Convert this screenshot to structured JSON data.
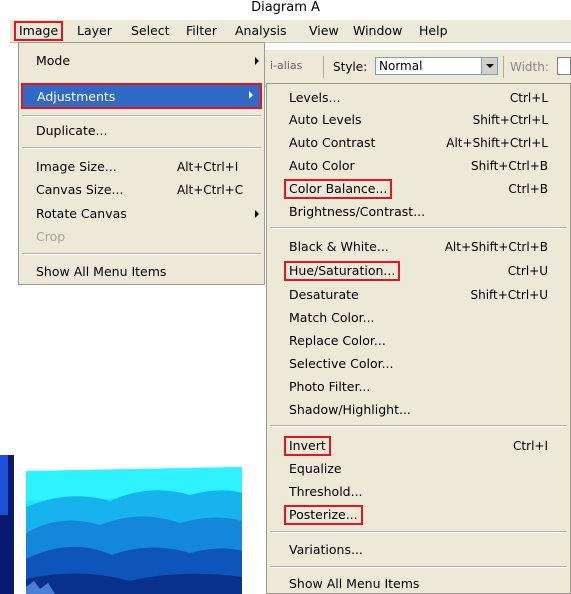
{
  "caption": "Diagram A",
  "menubar": {
    "items": [
      "Image",
      "Layer",
      "Select",
      "Filter",
      "Analysis",
      "View",
      "Window",
      "Help"
    ]
  },
  "options_bar": {
    "antialias_label": "i-alias",
    "style_label": "Style:",
    "style_value": "Normal",
    "width_label": "Width:"
  },
  "image_menu": {
    "mode": "Mode",
    "adjustments": "Adjustments",
    "duplicate": "Duplicate...",
    "image_size": "Image Size...",
    "image_size_shortcut": "Alt+Ctrl+I",
    "canvas_size": "Canvas Size...",
    "canvas_size_shortcut": "Alt+Ctrl+C",
    "rotate_canvas": "Rotate Canvas",
    "crop": "Crop",
    "show_all": "Show All Menu Items"
  },
  "adjustments_menu": {
    "levels": "Levels...",
    "levels_sc": "Ctrl+L",
    "auto_levels": "Auto Levels",
    "auto_levels_sc": "Shift+Ctrl+L",
    "auto_contrast": "Auto Contrast",
    "auto_contrast_sc": "Alt+Shift+Ctrl+L",
    "auto_color": "Auto Color",
    "auto_color_sc": "Shift+Ctrl+B",
    "color_balance": "Color Balance...",
    "color_balance_sc": "Ctrl+B",
    "brightness_contrast": "Brightness/Contrast...",
    "black_white": "Black & White...",
    "black_white_sc": "Alt+Shift+Ctrl+B",
    "hue_saturation": "Hue/Saturation...",
    "hue_saturation_sc": "Ctrl+U",
    "desaturate": "Desaturate",
    "desaturate_sc": "Shift+Ctrl+U",
    "match_color": "Match Color...",
    "replace_color": "Replace Color...",
    "selective_color": "Selective Color...",
    "photo_filter": "Photo Filter...",
    "shadow_highlight": "Shadow/Highlight...",
    "invert": "Invert",
    "invert_sc": "Ctrl+I",
    "equalize": "Equalize",
    "threshold": "Threshold...",
    "posterize": "Posterize...",
    "variations": "Variations...",
    "show_all": "Show All Menu Items"
  },
  "colors": {
    "menu_bg": "#ece9d8",
    "highlight": "#3169c6",
    "annotation_red": "#e5151b"
  }
}
